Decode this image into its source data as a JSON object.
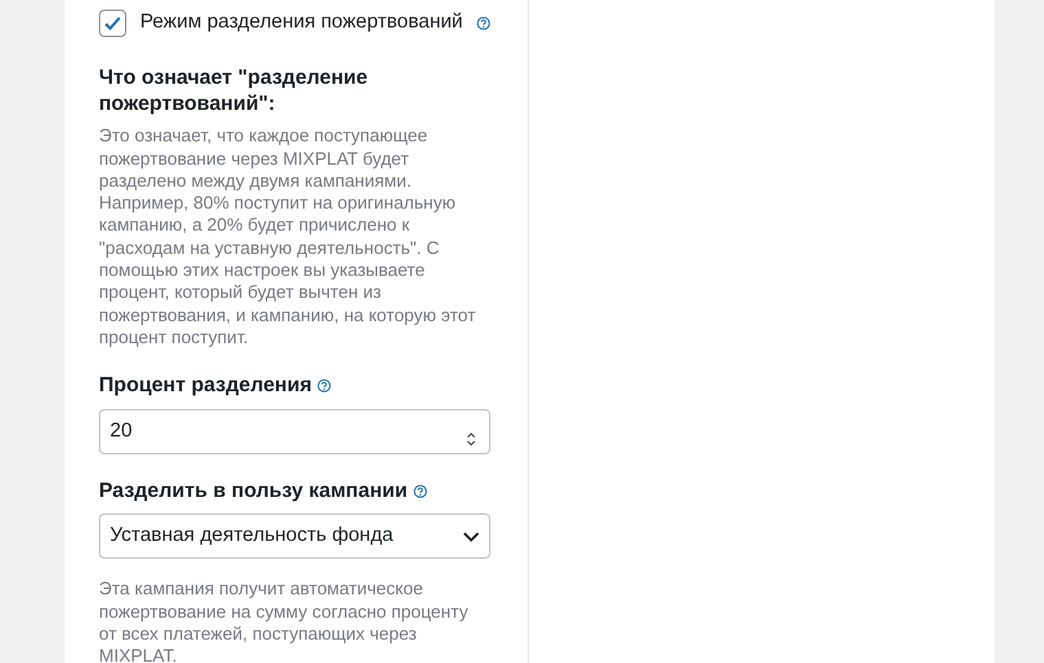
{
  "split_mode": {
    "label": "Режим разделения пожертвований",
    "checked": true
  },
  "explanation": {
    "title": "Что означает \"разделение пожертвований\":",
    "text": "Это означает, что каждое поступающее пожертвование через MIXPLAT будет разделено между двумя кампаниями. Например, 80% поступит на оригинальную кампанию, а 20% будет причислено к \"расходам на уставную деятельность\". С помощью этих настроек вы указываете процент, который будет вычтен из пожертвования, и кампанию, на которую этот процент поступит."
  },
  "percent": {
    "label": "Процент разделения",
    "value": "20"
  },
  "campaign": {
    "label": "Разделить в пользу кампании",
    "value": "Уставная деятельность фонда",
    "hint": "Эта кампания получит автоматическое пожертвование на сумму согласно проценту от всех платежей, поступающих через MIXPLAT."
  }
}
